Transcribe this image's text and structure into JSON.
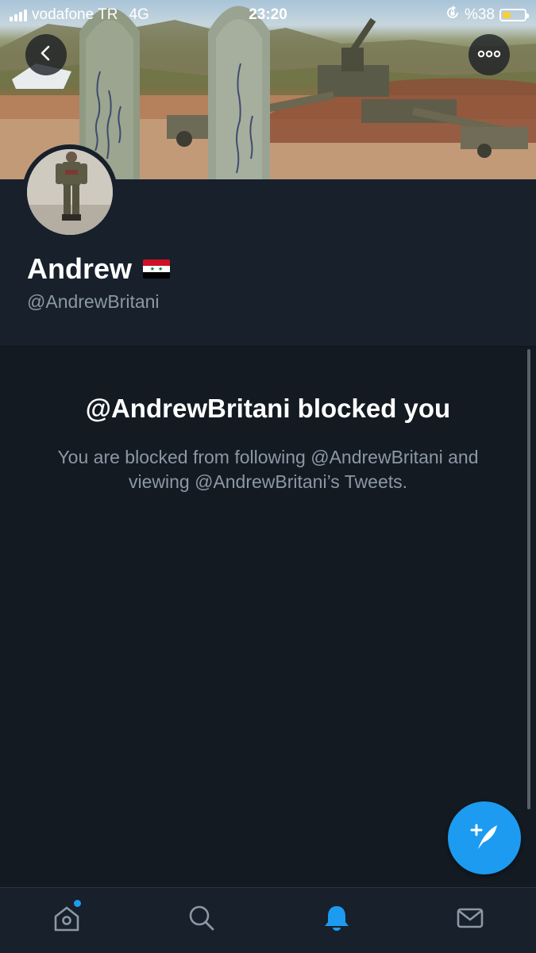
{
  "status_bar": {
    "carrier": "vodafone TR",
    "network": "4G",
    "time": "23:20",
    "battery_label": "%38",
    "battery_level": 0.38,
    "battery_color": "#f4d03f"
  },
  "header": {
    "back_icon": "chevron-left-icon",
    "more_icon": "more-horizontal-icon"
  },
  "profile": {
    "name": "Andrew",
    "flag": "syria-flag",
    "handle": "@AndrewBritani"
  },
  "blocked": {
    "title": "@AndrewBritani blocked you",
    "message": "You are blocked from following @AndrewBritani and viewing @AndrewBritani’s Tweets."
  },
  "compose": {
    "icon": "compose-tweet-icon"
  },
  "tab_bar": {
    "items": [
      {
        "name": "home",
        "icon": "home-icon",
        "has_notification_dot": true
      },
      {
        "name": "search",
        "icon": "search-icon"
      },
      {
        "name": "notifications",
        "icon": "bell-icon",
        "active": true
      },
      {
        "name": "messages",
        "icon": "mail-icon"
      }
    ]
  },
  "colors": {
    "background": "#141a22",
    "surface": "#17202b",
    "accent": "#1d9bf0",
    "secondary_text": "#8b98a5"
  }
}
